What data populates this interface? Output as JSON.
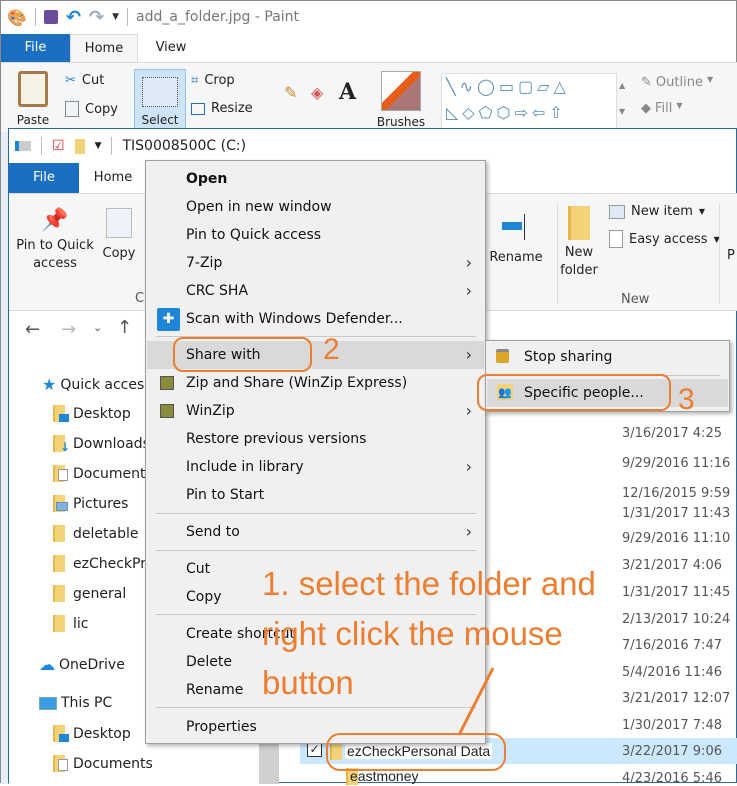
{
  "paint": {
    "title": "add_a_folder.jpg - Paint",
    "tabs": [
      "File",
      "Home",
      "View"
    ],
    "ribbon": {
      "paste": "Paste",
      "cut": "Cut",
      "copy": "Copy",
      "select": "Select",
      "crop": "Crop",
      "resize": "Resize",
      "brushes": "Brushes",
      "outline": "Outline",
      "fill": "Fill"
    }
  },
  "explorer": {
    "title": "TIS0008500C (C:)",
    "tabs": [
      "File",
      "Home"
    ],
    "ribbon": {
      "pin_quick_access": "Pin to Quick access",
      "copy": "Copy",
      "clipboard_group": "Cl",
      "rename": "Rename",
      "new_folder": "New folder",
      "new_item": "New item",
      "easy_access": "Easy access",
      "new_group": "New",
      "properties_partial": "P"
    },
    "nav_pane": [
      {
        "label": "Quick access",
        "icon": "star-icon"
      },
      {
        "label": "Desktop",
        "icon": "desktop-folder-icon"
      },
      {
        "label": "Downloads",
        "icon": "downloads-folder-icon"
      },
      {
        "label": "Documents",
        "icon": "documents-folder-icon"
      },
      {
        "label": "Pictures",
        "icon": "pictures-folder-icon"
      },
      {
        "label": "deletable",
        "icon": "folder-icon"
      },
      {
        "label": "ezCheckPr",
        "icon": "folder-icon"
      },
      {
        "label": "general",
        "icon": "folder-icon"
      },
      {
        "label": "lic",
        "icon": "folder-icon"
      },
      {
        "label": "OneDrive",
        "icon": "cloud-icon"
      },
      {
        "label": "This PC",
        "icon": "computer-icon"
      },
      {
        "label": "Desktop",
        "icon": "desktop-folder-icon"
      },
      {
        "label": "Documents",
        "icon": "documents-folder-icon"
      }
    ],
    "dates": [
      "3/16/2017 4:25",
      "9/29/2016 11:16",
      "12/16/2015 9:59",
      "1/31/2017 11:43",
      "9/29/2016 11:10",
      "3/21/2017 4:06",
      "1/31/2017 11:45",
      "2/13/2017 10:24",
      "7/16/2016 7:47",
      "5/4/2016 11:46",
      "3/21/2017 12:07",
      "1/30/2017 7:48",
      "3/22/2017 9:06",
      "4/23/2016 5:46"
    ],
    "selected_file": "ezCheckPersonal Data",
    "next_file": "eastmoney"
  },
  "context_menu": {
    "items": [
      {
        "label": "Open",
        "bold": true
      },
      {
        "label": "Open in new window"
      },
      {
        "label": "Pin to Quick access"
      },
      {
        "label": "7-Zip",
        "submenu": true
      },
      {
        "label": "CRC SHA",
        "submenu": true
      },
      {
        "label": "Scan with Windows Defender...",
        "icon": "windows-defender-icon"
      },
      {
        "label": "Share with",
        "submenu": true,
        "highlighted": true
      },
      {
        "label": "Zip and Share (WinZip Express)",
        "icon": "winzip-icon"
      },
      {
        "label": "WinZip",
        "submenu": true,
        "icon": "winzip-icon"
      },
      {
        "label": "Restore previous versions"
      },
      {
        "label": "Include in library",
        "submenu": true
      },
      {
        "label": "Pin to Start"
      },
      {
        "label": "Send to",
        "submenu": true
      },
      {
        "label": "Cut"
      },
      {
        "label": "Copy"
      },
      {
        "label": "Create shortcut"
      },
      {
        "label": "Delete"
      },
      {
        "label": "Rename"
      },
      {
        "label": "Properties"
      }
    ],
    "arrow": "›"
  },
  "share_submenu": {
    "items": [
      {
        "label": "Stop sharing",
        "icon": "lock-icon"
      },
      {
        "label": "Specific people...",
        "icon": "people-icon",
        "highlighted": true
      }
    ]
  },
  "annotations": {
    "step1": "1. select the folder and right click the mouse button",
    "step1_line1": "1. select the folder and",
    "step1_line2": "right click the mouse",
    "step1_line3": "button",
    "step2": "2",
    "step3": "3",
    "color": "#ed7d31"
  }
}
